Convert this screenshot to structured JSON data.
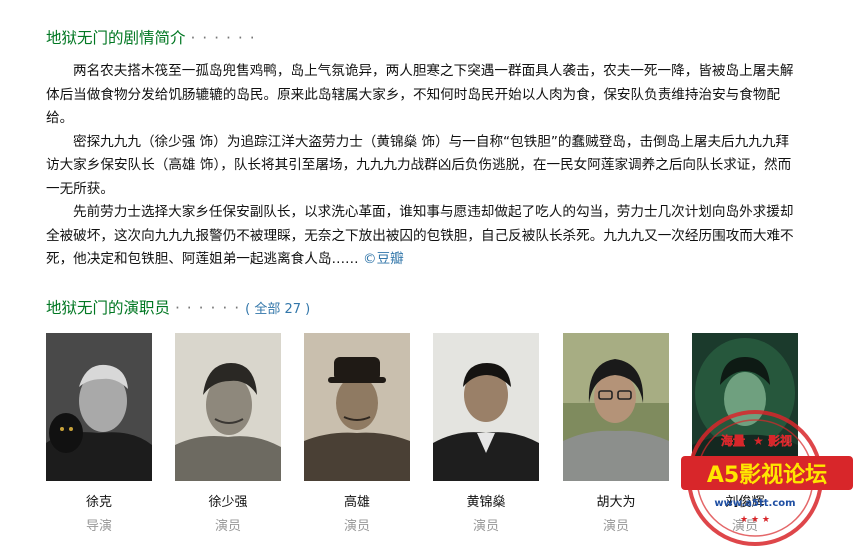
{
  "synopsis": {
    "title": "地狱无门的剧情简介",
    "dots": "· · · · · ·",
    "paragraphs": [
      "两名农夫搭木筏至一孤岛兜售鸡鸭，岛上气氛诡异，两人胆寒之下突遇一群面具人袭击，农夫一死一降，皆被岛上屠夫解体后当做食物分发给饥肠辘辘的岛民。原来此岛辖属大家乡，不知何时岛民开始以人肉为食，保安队负责维持治安与食物配给。",
      "密探九九九（徐少强 饰）为追踪江洋大盗劳力士（黄锦燊 饰）与一自称“包铁胆”的蠢贼登岛，击倒岛上屠夫后九九九拜访大家乡保安队长（高雄 饰），队长将其引至屠场，九九九力战群凶后负伤逃脱，在一民女阿莲家调养之后向队长求证，然而一无所获。",
      "先前劳力士选择大家乡任保安副队长，以求洗心革面，谁知事与愿违却做起了吃人的勾当，劳力士几次计划向岛外求援却全被破坏，这次向九九九报警仍不被理睬，无奈之下放出被囚的包铁胆，自己反被队长杀死。九九九又一次经历围攻而大难不死，他决定和包铁胆、阿莲姐弟一起逃离食人岛……"
    ],
    "source": "©豆瓣"
  },
  "cast": {
    "title": "地狱无门的演职员",
    "dots": "· · · · · ·",
    "all_link": "全部 27",
    "members": [
      {
        "name": "徐克",
        "role": "导演"
      },
      {
        "name": "徐少强",
        "role": "演员"
      },
      {
        "name": "高雄",
        "role": "演员"
      },
      {
        "name": "黄锦燊",
        "role": "演员"
      },
      {
        "name": "胡大为",
        "role": "演员"
      },
      {
        "name": "刘俊辉",
        "role": "演员"
      }
    ]
  },
  "watermark": {
    "top_left": "海量",
    "top_right": "影视",
    "banner": "A5影视论坛",
    "url": "www.a5tt.com"
  },
  "colors": {
    "title_green": "#007722",
    "link_blue": "#3377aa",
    "stamp_red": "#d8262a"
  }
}
